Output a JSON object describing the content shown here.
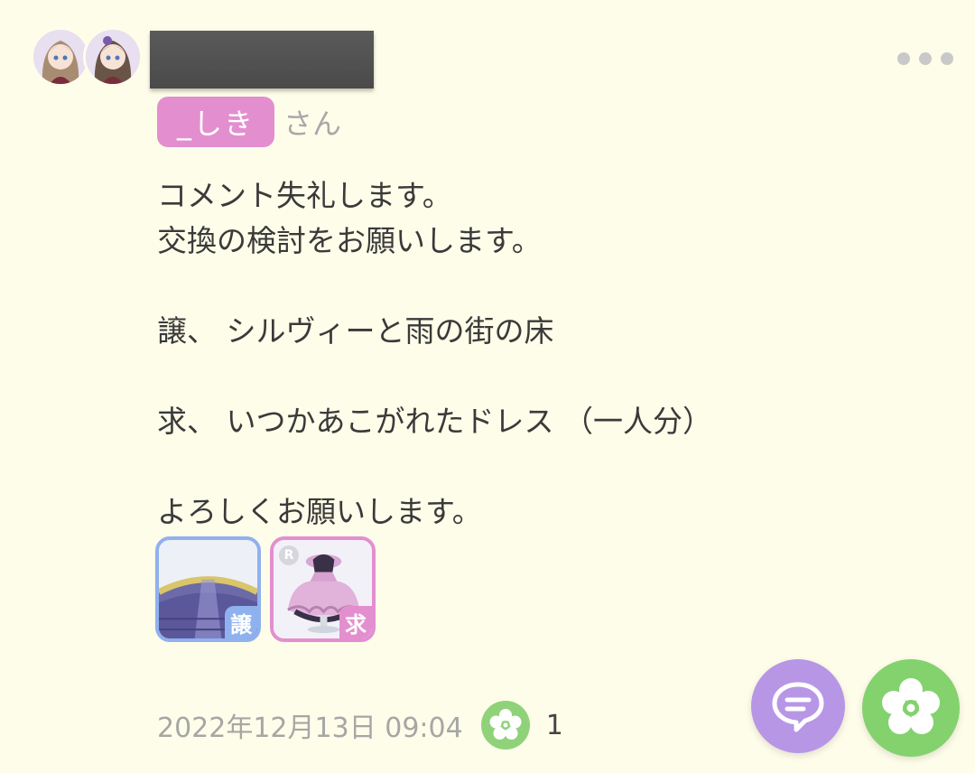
{
  "post": {
    "mention": "_しき",
    "mention_suffix": "さん",
    "lines": [
      "コメント失礼します。",
      "交換の検討をお願いします。",
      "",
      "譲、 シルヴィーと雨の街の床",
      "",
      "求、 いつかあこがれたドレス （一人分）",
      "",
      "よろしくお願いします。"
    ]
  },
  "items": [
    {
      "type": "give",
      "tag": "譲",
      "icon": "rainy-street-floor-icon"
    },
    {
      "type": "want",
      "tag": "求",
      "rarity": "R",
      "icon": "dress-icon"
    }
  ],
  "footer": {
    "timestamp": "2022年12月13日 09:04",
    "like_count": "1"
  },
  "colors": {
    "background": "#fefde9",
    "mention": "#e38fcf",
    "give": "#8fb1ee",
    "want": "#e38fcf",
    "like": "#83d26e",
    "comment_button": "#b796e6"
  }
}
